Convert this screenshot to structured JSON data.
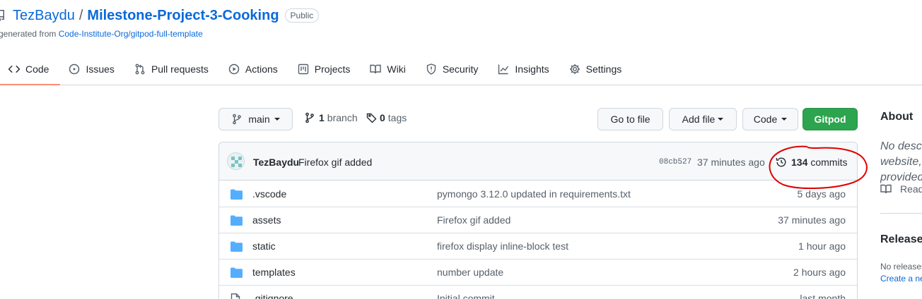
{
  "repo": {
    "owner": "TezBaydu",
    "separator": "/",
    "name": "Milestone-Project-3-Cooking",
    "visibility": "Public",
    "generated_prefix": "generated from ",
    "template_link": "Code-Institute-Org/gitpod-full-template"
  },
  "tabs": [
    {
      "label": "Code",
      "icon": "code-icon",
      "selected": true
    },
    {
      "label": "Issues",
      "icon": "issue-icon"
    },
    {
      "label": "Pull requests",
      "icon": "pull-request-icon"
    },
    {
      "label": "Actions",
      "icon": "play-icon"
    },
    {
      "label": "Projects",
      "icon": "project-icon"
    },
    {
      "label": "Wiki",
      "icon": "book-icon"
    },
    {
      "label": "Security",
      "icon": "shield-icon"
    },
    {
      "label": "Insights",
      "icon": "graph-icon"
    },
    {
      "label": "Settings",
      "icon": "gear-icon"
    }
  ],
  "branch_bar": {
    "branch": "main",
    "branch_count": "1",
    "branch_label": "branch",
    "tag_count": "0",
    "tag_label": "tags",
    "go_to_file": "Go to file",
    "add_file": "Add file",
    "code": "Code",
    "gitpod": "Gitpod",
    "gitpod_color": "#2da44e"
  },
  "latest_commit": {
    "author": "TezBaydu",
    "message": "Firefox gif added",
    "sha": "08cb527",
    "time": "37 minutes ago",
    "commit_count": "134",
    "commit_label": "commits"
  },
  "annotation_color": "#e00000",
  "files": [
    {
      "name": ".vscode",
      "type": "folder",
      "message": "pymongo 3.12.0 updated in requirements.txt",
      "age": "5 days ago"
    },
    {
      "name": "assets",
      "type": "folder",
      "message": "Firefox gif added",
      "age": "37 minutes ago"
    },
    {
      "name": "static",
      "type": "folder",
      "message": "firefox display inline-block test",
      "age": "1 hour ago"
    },
    {
      "name": "templates",
      "type": "folder",
      "message": "number update",
      "age": "2 hours ago"
    },
    {
      "name": ".gitignore",
      "type": "file",
      "message": "Initial commit",
      "age": "last month"
    }
  ],
  "sidebar": {
    "about_heading": "About",
    "about_description": "No description, website, or topics provided.",
    "readme": "Readme",
    "releases_heading": "Releases",
    "no_releases": "No releases published",
    "create_release": "Create a new release"
  }
}
